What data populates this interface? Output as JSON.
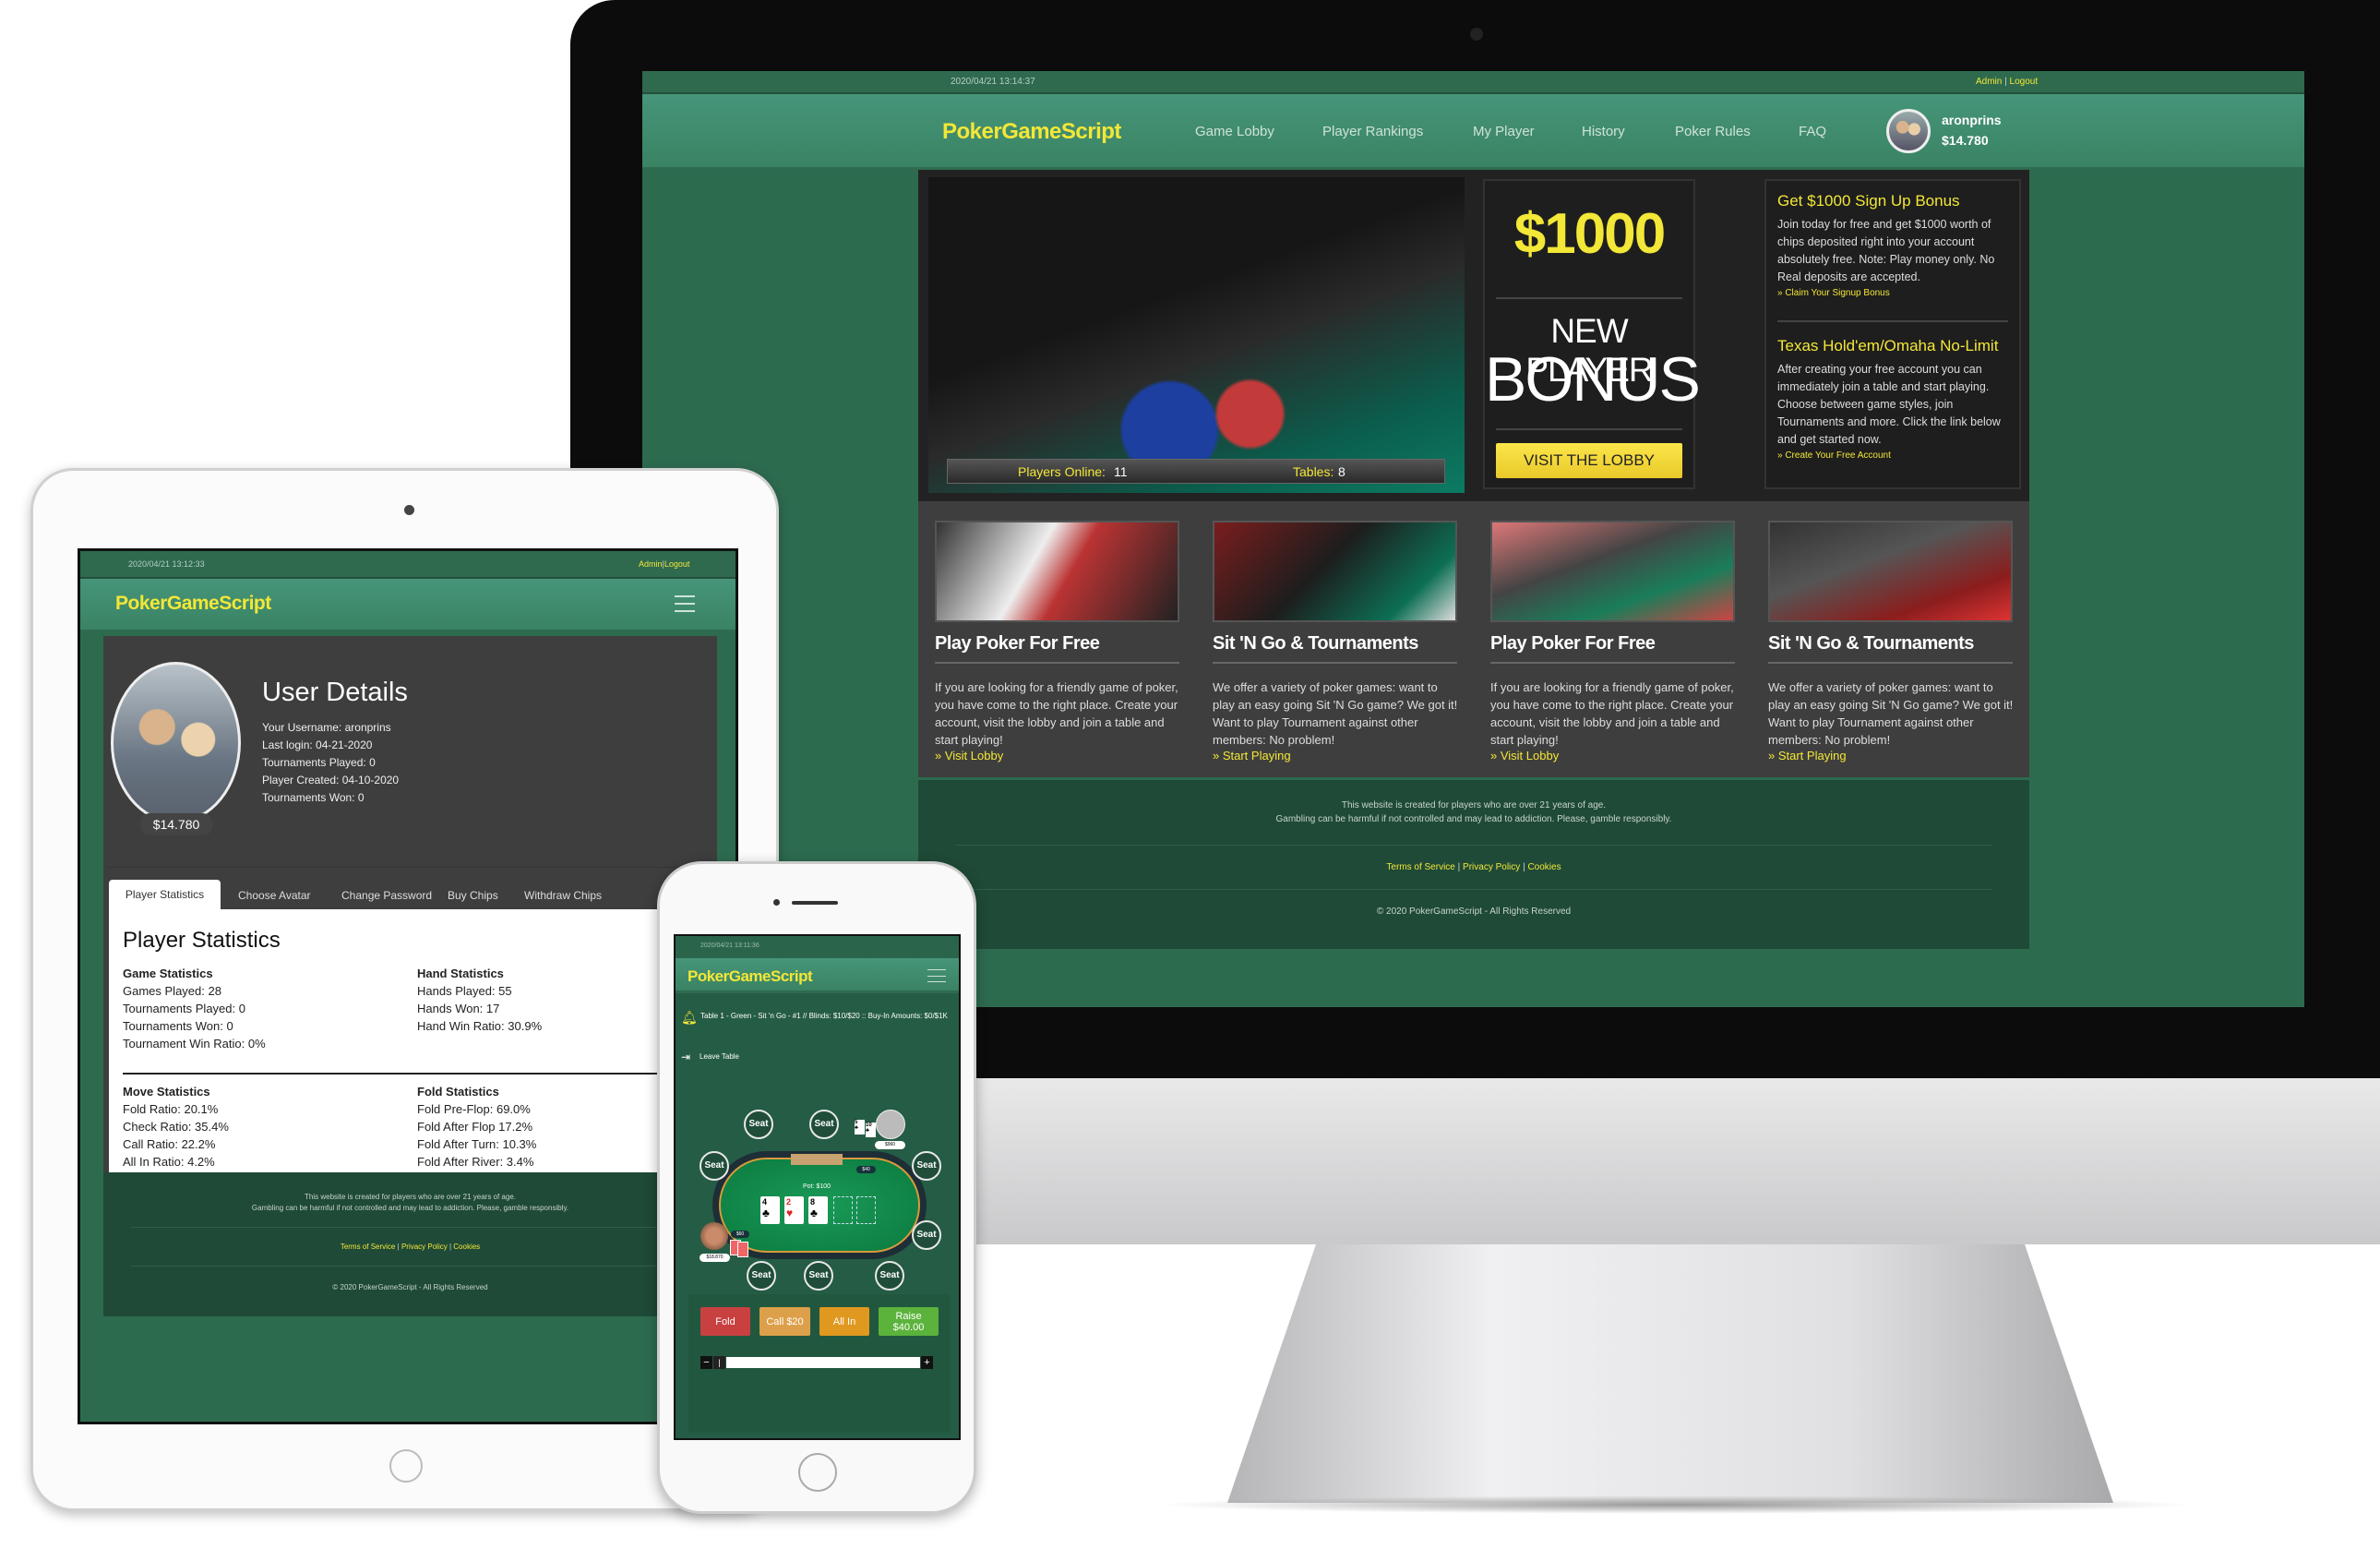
{
  "desktop": {
    "timestamp": "2020/04/21 13:14:37",
    "admin": "Admin",
    "logout": "Logout",
    "sep": "|",
    "logo": "PokerGameScript",
    "nav": [
      "Game Lobby",
      "Player Rankings",
      "My Player",
      "History",
      "Poker Rules",
      "FAQ"
    ],
    "username": "aronprins",
    "balance": "$14.780",
    "hero": {
      "players_online_label": "Players Online:",
      "players_online": "11",
      "tables_label": "Tables:",
      "tables": "8"
    },
    "bonus": {
      "amount": "$1000",
      "line1": "NEW PLAYER",
      "line2": "BONUS",
      "button": "VISIT THE LOBBY"
    },
    "info": [
      {
        "title": "Get $1000 Sign Up Bonus",
        "text": "Join today for free and get $1000 worth of chips deposited right into your account absolutely free. Note: Play money only. No Real deposits are accepted.",
        "link": "» Claim Your Signup Bonus"
      },
      {
        "title": "Texas Hold'em/Omaha No-Limit",
        "text": "After creating your free account you can immediately join a table and start playing. Choose between game styles, join Tournaments and more. Click the link below and get started now.",
        "link": "» Create Your Free Account"
      }
    ],
    "cards": [
      {
        "title": "Play Poker For Free",
        "text": "If you are looking for a friendly game of poker, you have come to the right place. Create your account, visit the lobby and join a table and start playing!",
        "link": "» Visit Lobby"
      },
      {
        "title": "Sit 'N Go & Tournaments",
        "text": "We offer a variety of poker games: want to play an easy going Sit 'N Go game? We got it! Want to play Tournament against other members: No problem!",
        "link": "» Start Playing"
      },
      {
        "title": "Play Poker For Free",
        "text": "If you are looking for a friendly game of poker, you have come to the right place. Create your account, visit the lobby and join a table and start playing!",
        "link": "» Visit Lobby"
      },
      {
        "title": "Sit 'N Go & Tournaments",
        "text": "We offer a variety of poker games: want to play an easy going Sit 'N Go game? We got it! Want to play Tournament against other members: No problem!",
        "link": "» Start Playing"
      }
    ]
  },
  "footer": {
    "line1": "This website is created for players who are over 21 years of age.",
    "line2": "Gambling can be harmful if not controlled and may lead to addiction. Please, gamble responsibly.",
    "terms": "Terms of Service",
    "privacy": "Privacy Policy",
    "cookies": "Cookies",
    "sep": "|",
    "copyright": "© 2020 PokerGameScript - All Rights Reserved"
  },
  "tablet": {
    "timestamp": "2020/04/21 13:12:33",
    "heading": "User Details",
    "details": [
      "Your Username: aronprins",
      "Last login: 04-21-2020",
      "Tournaments Played: 0",
      "Player Created: 04-10-2020",
      "Tournaments Won: 0"
    ],
    "balance": "$14.780",
    "tabs": [
      "Player Statistics",
      "Choose Avatar",
      "Change Password",
      "Buy Chips",
      "Withdraw Chips"
    ],
    "stats_title": "Player Statistics",
    "groups": [
      {
        "title": "Game Statistics",
        "items": [
          "Games Played: 28",
          "Tournaments Played: 0",
          "Tournaments Won: 0",
          "Tournament Win Ratio: 0%"
        ]
      },
      {
        "title": "Hand Statistics",
        "items": [
          "Hands Played: 55",
          "Hands Won: 17",
          "Hand Win Ratio: 30.9%"
        ]
      },
      {
        "title": "Move Statistics",
        "items": [
          "Fold Ratio: 20.1%",
          "Check Ratio: 35.4%",
          "Call Ratio: 22.2%",
          "All In Ratio: 4.2%"
        ]
      },
      {
        "title": "Fold Statistics",
        "items": [
          "Fold Pre-Flop: 69.0%",
          "Fold After Flop 17.2%",
          "Fold After Turn: 10.3%",
          "Fold After River: 3.4%"
        ]
      }
    ]
  },
  "phone": {
    "timestamp": "2020/04/21 13:11:36",
    "table_info": "Table 1 - Green - Sit 'n Go - #1 // Blinds: $10/$20 :: Buy-In Amounts: $0/$1K",
    "leave": "Leave Table",
    "seat": "Seat",
    "pot": "Pot: $100",
    "board": [
      {
        "rank": "4",
        "suit": "♣"
      },
      {
        "rank": "2",
        "suit": "♥"
      },
      {
        "rank": "8",
        "suit": "♣"
      }
    ],
    "opponent_cards": [
      {
        "rank": "5",
        "suit": "♣"
      },
      {
        "rank": "10",
        "suit": "♣"
      }
    ],
    "opponent_stack": "$960",
    "opponent_bet": "$40",
    "player_stack": "$18.870",
    "player_bet": "$60",
    "buttons": {
      "fold": "Fold",
      "call": "Call $20",
      "allin": "All In",
      "raise": "Raise",
      "raise_amount": "$40.00"
    },
    "minus": "−",
    "plus": "+"
  },
  "colors": {
    "brand_green": "#3a8363",
    "accent_yellow": "#f3e737",
    "dark_panel": "#3e3e3e"
  }
}
